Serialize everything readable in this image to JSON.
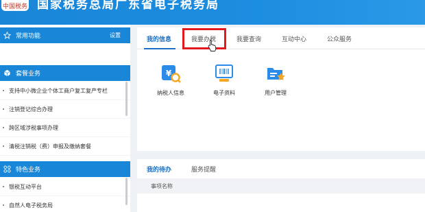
{
  "banner": {
    "logo_text": "中国税务",
    "title": "国家税务总局广东省电子税务局"
  },
  "sidebar": {
    "common": {
      "title": "常用功能",
      "settings": "设置"
    },
    "package": {
      "title": "套餐业务",
      "items": [
        "支持中小微企业个体工商户复工复产专栏",
        "注销登记综合办理",
        "跨区域涉税事项办理",
        "清税注销税（费）申报及缴纳套餐"
      ]
    },
    "special": {
      "title": "特色业务",
      "items": [
        "银税互动平台",
        "自然人电子税务局"
      ]
    }
  },
  "main": {
    "tabs": [
      "我的信息",
      "我要办税",
      "我要查询",
      "互动中心",
      "公众服务"
    ],
    "active_tab": 0,
    "highlighted_tab": 1,
    "features": [
      {
        "label": "纳税人信息",
        "icon": "taxpayer-info-icon"
      },
      {
        "label": "电子资料",
        "icon": "electronic-documents-icon"
      },
      {
        "label": "用户管理",
        "icon": "user-management-icon"
      }
    ]
  },
  "todo": {
    "tabs": [
      "我的待办",
      "服务提醒"
    ],
    "active_tab": 0,
    "column_header": "事项名称"
  },
  "colors": {
    "brand_blue": "#1a86d8",
    "tab_active": "#1a6fc4",
    "highlight_red": "#e0191e",
    "icon_blue": "#2a8be8",
    "icon_orange": "#f4a623"
  }
}
